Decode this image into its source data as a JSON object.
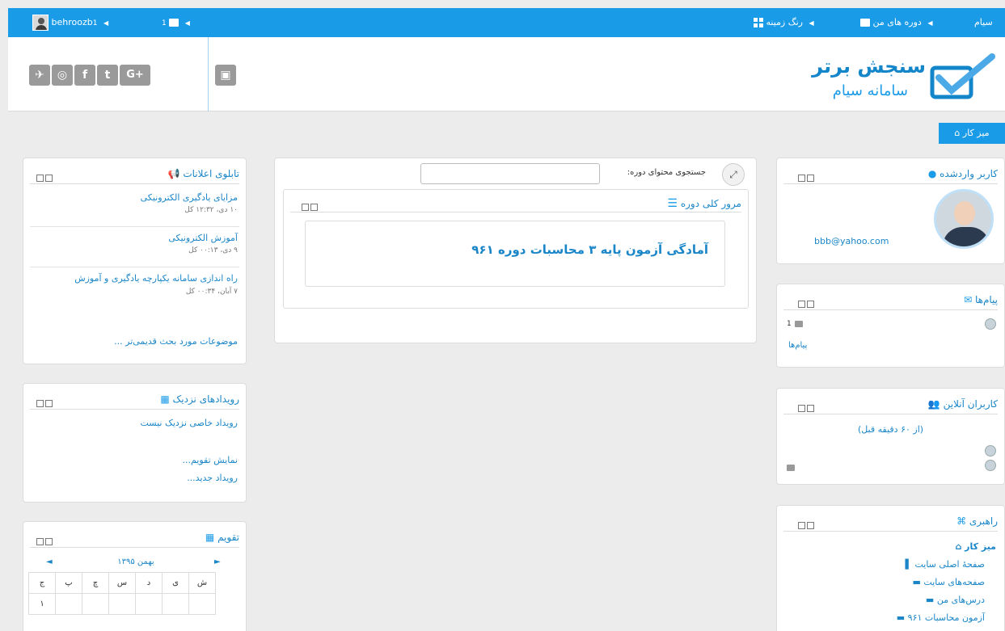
{
  "topbar": {
    "user": "behroozb",
    "messages_count": "1",
    "site_name": "سیام",
    "my_courses": "دوره های من",
    "theme_color": "رنگ زمینه"
  },
  "header": {
    "social": [
      "G+",
      "t",
      "f",
      "◎",
      "◉",
      "▣"
    ],
    "logo_title": "سنجش برتر",
    "logo_subtitle": "سامانه سیام"
  },
  "dashboard": {
    "label": "میز کار"
  },
  "logged_user": {
    "title": "کاربر واردشده",
    "email": "bbb@yahoo.com"
  },
  "messages": {
    "title": "پیام‌ها",
    "count": "1",
    "link": "پیام‌ها"
  },
  "online_users": {
    "title": "کاربران آنلاین",
    "subtitle": "(از ۶۰ دقیقه قبل)"
  },
  "navigation": {
    "title": "راهبری",
    "items": [
      "میز کار",
      "صفحهٔ اصلی سایت",
      "صفحه‌های سایت",
      "درس‌های من",
      "آزمون محاسبات ۹۶۱"
    ]
  },
  "course": {
    "search_label": "جستجوی محتوای دوره:",
    "search_value": "",
    "overview_title": "مرور کلی دوره",
    "course_name": "آمادگی آزمون پایه ۳ محاسبات دوره ۹۶۱"
  },
  "news": {
    "title": "تابلوی اعلانات",
    "items": [
      {
        "title": "مزایای یادگیری الکترونیکی",
        "date": "۱۰ دی، ۱۲:۳۲ کل"
      },
      {
        "title": "آموزش الکترونیکی",
        "date": "۹ دی، ۰۰:۱۳ کل"
      },
      {
        "title": "راه اندازی سامانه یکپارچه یادگیری و آموزش",
        "date": "۷ آبان، ۰۰:۳۴ کل"
      }
    ],
    "older": "موضوعات مورد بحث قدیمی‌تر ..."
  },
  "events": {
    "title": "رویدادهای نزدیک",
    "empty": "رویداد خاصی نزدیک نیست",
    "show_calendar": "نمایش تقویم...",
    "new_event": "رویداد جدید..."
  },
  "calendar": {
    "title": "تقویم",
    "month": "بهمن ۱۳۹۵",
    "days": [
      "ش",
      "ی",
      "د",
      "س",
      "چ",
      "پ",
      "ج"
    ],
    "first_day": "۱"
  },
  "colors": {
    "primary": "#1a9be8",
    "link": "#1a86c8",
    "background": "#ececec"
  }
}
